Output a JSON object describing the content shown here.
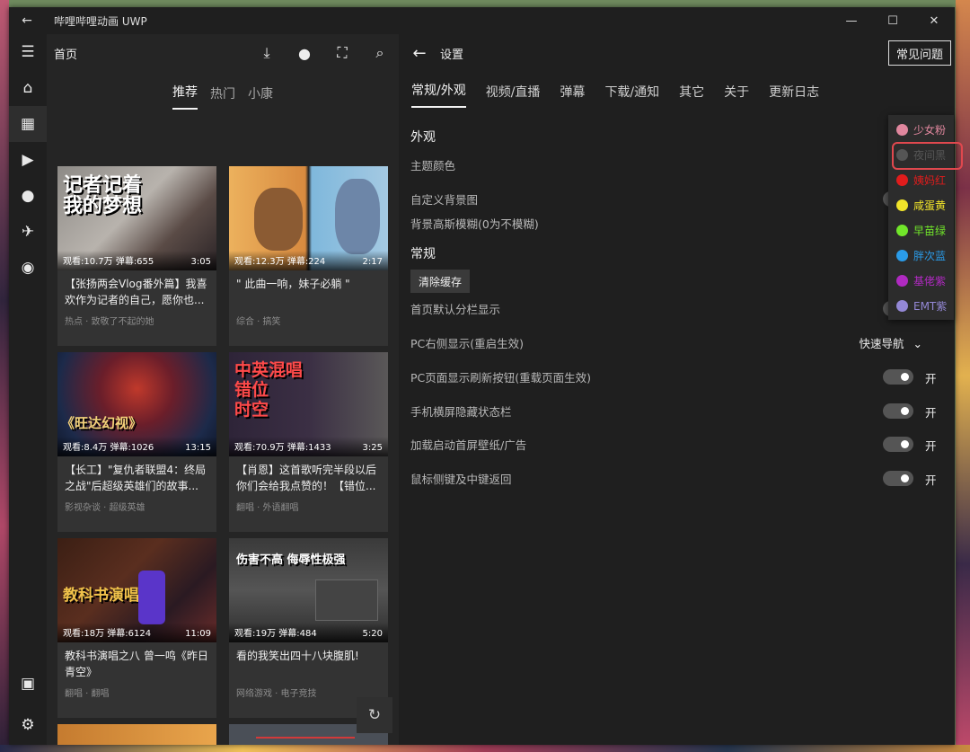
{
  "window": {
    "title": "哔哩哔哩动画 UWP",
    "controls": {
      "minimize": "—",
      "maximize": "☐",
      "close": "✕"
    }
  },
  "left": {
    "header_title": "首页",
    "tabs": [
      "推荐",
      "热门",
      "小康"
    ],
    "cards": [
      {
        "thumb_text": "记者记着\n我的梦想",
        "views": "观看:10.7万 弹幕:655",
        "duration": "3:05",
        "title": "【张扬两会Vlog番外篇】我喜欢作为记者的自己，愿你也...",
        "tag": "热点 · 致敬了不起的她"
      },
      {
        "thumb_text": "",
        "views": "观看:12.3万 弹幕:224",
        "duration": "2:17",
        "title": "\" 此曲一响，妹子必躺 \"",
        "tag": "综合 · 搞笑"
      },
      {
        "thumb_text": "《旺达幻视》",
        "views": "观看:8.4万 弹幕:1026",
        "duration": "13:15",
        "title": "【长工】\"复仇者联盟4：终局之战\"后超级英雄们的故事...",
        "tag": "影视杂谈 · 超级英雄"
      },
      {
        "thumb_text": "中英混唱\n错位\n时空",
        "views": "观看:70.9万 弹幕:1433",
        "duration": "3:25",
        "title": "【肖恩】这首歌听完半段以后你们会给我点赞的！【错位...",
        "tag": "翻唱 · 外语翻唱"
      },
      {
        "thumb_text": "教科书演唱之",
        "views": "观看:18万 弹幕:6124",
        "duration": "11:09",
        "title": "教科书演唱之八 曾一鸣《昨日青空》",
        "tag": "翻唱 · 翻唱"
      },
      {
        "thumb_text": "伤害不高 侮辱性极强",
        "views": "观看:19万 弹幕:484",
        "duration": "5:20",
        "title": "看的我笑出四十八块腹肌!",
        "tag": "网络游戏 · 电子竞技"
      }
    ]
  },
  "right": {
    "header_title": "设置",
    "faq_label": "常见问题",
    "tabs": [
      "常规/外观",
      "视频/直播",
      "弹幕",
      "下载/通知",
      "其它",
      "关于",
      "更新日志"
    ],
    "section_appearance": "外观",
    "theme_color_label": "主题颜色",
    "custom_bg_label": "自定义背景图",
    "blur_label": "背景高斯模糊(0为不模糊)",
    "section_general": "常规",
    "clear_cache_label": "清除缓存",
    "home_split_label": "首页默认分栏显示",
    "pc_right_label": "PC右侧显示(重启生效)",
    "pc_right_value": "快速导航",
    "settings": [
      {
        "label": "PC页面显示刷新按钮(重载页面生效)",
        "state": "开"
      },
      {
        "label": "手机横屏隐藏状态栏",
        "state": "开"
      },
      {
        "label": "加载启动首屏壁纸/广告",
        "state": "开"
      },
      {
        "label": "鼠标侧键及中键返回",
        "state": "开"
      }
    ]
  },
  "theme_colors": [
    {
      "name": "少女粉",
      "color": "#e0879e"
    },
    {
      "name": "夜间黑",
      "color": "#555555"
    },
    {
      "name": "姨妈红",
      "color": "#e01c1c"
    },
    {
      "name": "咸蛋黄",
      "color": "#f1e42a"
    },
    {
      "name": "早苗绿",
      "color": "#71e62a"
    },
    {
      "name": "胖次蓝",
      "color": "#2a9be8"
    },
    {
      "name": "基佬紫",
      "color": "#b02ac1"
    },
    {
      "name": "EMT紫",
      "color": "#9488d6"
    }
  ]
}
